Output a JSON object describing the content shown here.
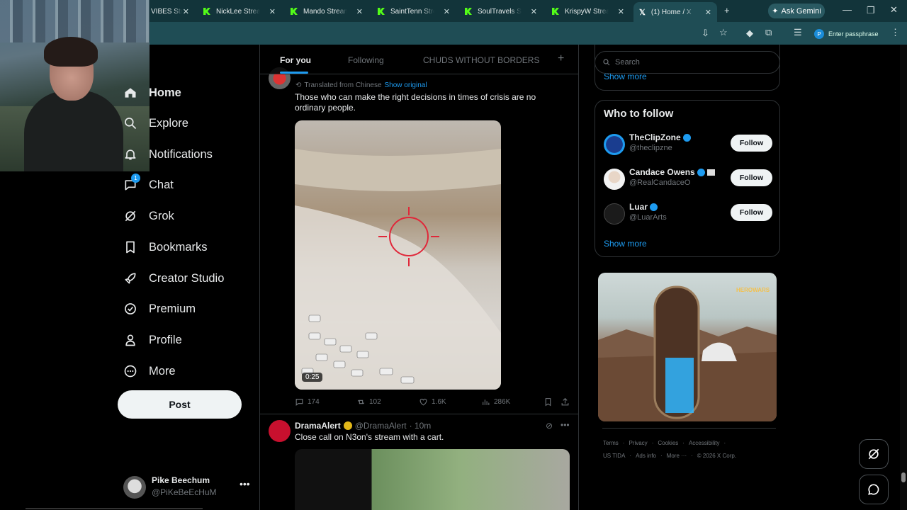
{
  "browser": {
    "tabs": [
      {
        "label": "VIBES Str..."
      },
      {
        "label": "NickLee Stream -"
      },
      {
        "label": "Mando Stream - \\"
      },
      {
        "label": "SaintTenn Stream"
      },
      {
        "label": "SoulTravels Strea"
      },
      {
        "label": "KrispyW Stream -"
      },
      {
        "label": "(1) Home / X"
      }
    ],
    "gemini_label": "Ask Gemini",
    "passphrase_label": "Enter passphrase",
    "profile_letter": "P"
  },
  "nav": {
    "items": [
      {
        "label": "Home",
        "icon": "home-icon"
      },
      {
        "label": "Explore",
        "icon": "search-icon"
      },
      {
        "label": "Notifications",
        "icon": "bell-icon"
      },
      {
        "label": "Chat",
        "icon": "chat-icon",
        "badge": "1"
      },
      {
        "label": "Grok",
        "icon": "grok-icon"
      },
      {
        "label": "Bookmarks",
        "icon": "bookmark-icon"
      },
      {
        "label": "Creator Studio",
        "icon": "rocket-icon"
      },
      {
        "label": "Premium",
        "icon": "verified-icon"
      },
      {
        "label": "Profile",
        "icon": "person-icon"
      },
      {
        "label": "More",
        "icon": "more-circle-icon"
      }
    ],
    "post_label": "Post"
  },
  "account": {
    "name": "Pike Beechum",
    "handle": "@PiKeBeEcHuM"
  },
  "feed": {
    "tabs": [
      "For you",
      "Following",
      "CHUDS WITHOUT BORDERS"
    ],
    "post1": {
      "translated": "Translated from Chinese",
      "show_original": "Show original",
      "text": "Those who can make the right decisions in times of crisis are no ordinary people.",
      "video_duration": "0:25",
      "replies": "174",
      "reposts": "102",
      "likes": "1.6K",
      "views": "286K"
    },
    "post2": {
      "name": "DramaAlert",
      "handle": "@DramaAlert",
      "time": "· 10m",
      "text": "Close call on N3on's stream with a cart."
    }
  },
  "sidebar": {
    "search_placeholder": "Search",
    "show_more": "Show more",
    "who_to_follow": "Who to follow",
    "suggestions": [
      {
        "name": "TheClipZone",
        "handle": "@theclipzne",
        "follow": "Follow"
      },
      {
        "name": "Candace Owens",
        "handle": "@RealCandaceO",
        "follow": "Follow"
      },
      {
        "name": "Luar",
        "handle": "@LuarArts",
        "follow": "Follow"
      }
    ],
    "show_more_2": "Show more",
    "ad_brand": "HEROWARS",
    "footer": {
      "terms": "Terms",
      "privacy": "Privacy",
      "cookies": "Cookies",
      "accessibility": "Accessibility",
      "tida": "US TIDA",
      "adsinfo": "Ads info",
      "more": "More ···",
      "copyright": "© 2026 X Corp."
    }
  },
  "colors": {
    "accent": "#1d9bf0",
    "kick": "#53fc18",
    "chrome_bg": "#12343a"
  }
}
